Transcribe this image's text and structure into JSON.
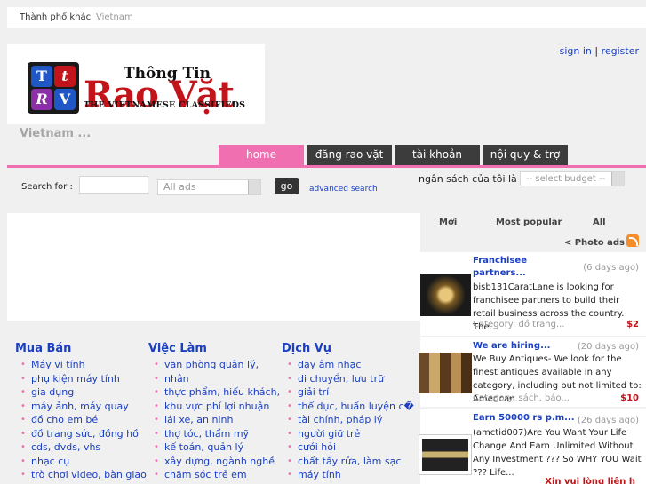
{
  "topbar": {
    "city_label": "Thành phố khác",
    "country": "Vietnam"
  },
  "logo": {
    "tiles": [
      "T",
      "t",
      "R",
      "V"
    ],
    "title": "Thông Tin",
    "main": "Rao Vặt",
    "subtitle": "THE VIETNAMESE CLASSIFIEDS"
  },
  "auth": {
    "sign_in": "sign in",
    "separator": " | ",
    "register": "register"
  },
  "region": "Vietnam ...",
  "nav": [
    "home",
    "đăng rao vặt",
    "tài khoản",
    "nội quy & trợ"
  ],
  "search": {
    "label": "Search for :",
    "query": "",
    "category_select": "All ads",
    "go": "go",
    "advanced": "advanced search",
    "budget_label": "ngân sách của tôi là $",
    "budget_select": "-- select budget --"
  },
  "right_panel": {
    "tabs": [
      "Mới",
      "Most popular",
      "All"
    ],
    "photo_ads": "< Photo ads",
    "listings": [
      {
        "title_line1": "Franchisee",
        "title_line2": "partners...",
        "age": "(6 days ago)",
        "desc": "bisb131CaratLane is looking for franchisee partners to build their retail business across the country. The...",
        "category": "Category: đồ trang...",
        "price": "$2"
      },
      {
        "title_line1": "We are hiring...",
        "title_line2": "",
        "age": "(20 days ago)",
        "desc": "We Buy Antiques- We look for the finest antiques available in any category, including but not limited to: American...",
        "category": "Category: sách, báo...",
        "price": "$10"
      },
      {
        "title_line1": "Earn 50000 rs p.m...",
        "title_line2": "",
        "age": "(26 days ago)",
        "desc": "(amctid007)Are You Want Your Life Change And Earn Unlimited Without Any Investment ??? So WHY YOU Wait ??? Life...",
        "category": "",
        "price": ""
      }
    ],
    "more_link": "Xin vui lòng liên h"
  },
  "categories": [
    {
      "heading": "Mua Bán",
      "items": [
        "Máy vi tính",
        "phụ kiện máy tính",
        "gia dụng",
        "máy ảnh, máy quay",
        "đồ cho em bé",
        "đồ trang sức, đồng hồ",
        "cds, dvds, vhs",
        "nhạc cụ",
        "trò chơi video, bàn giao"
      ]
    },
    {
      "heading": "Việc Làm",
      "items": [
        "văn phòng quản lý,",
        "nhân",
        "thực phẩm, hiếu khách,",
        "khu vực phí lợi nhuận",
        "lái xe, an ninh",
        "thợ tóc, thẩm mỹ",
        "kế toán, quản lý",
        "xây dựng, ngành nghề",
        "chăm sóc trẻ em"
      ]
    },
    {
      "heading": "Dịch Vụ",
      "items": [
        "dạy âm nhạc",
        "di chuyển, lưu trữ",
        "giải trí",
        "thể dục, huấn luyện c�",
        "tài chính, pháp lý",
        "người giữ trẻ",
        "cưới hỏi",
        "chất tẩy rửa, làm sạc",
        "máy tính"
      ]
    }
  ],
  "colors": {
    "accent_pink": "#f06fb0",
    "nav_dark": "#3c3c3c",
    "link_blue": "#1a3fc0",
    "brand_red": "#c2151b"
  }
}
